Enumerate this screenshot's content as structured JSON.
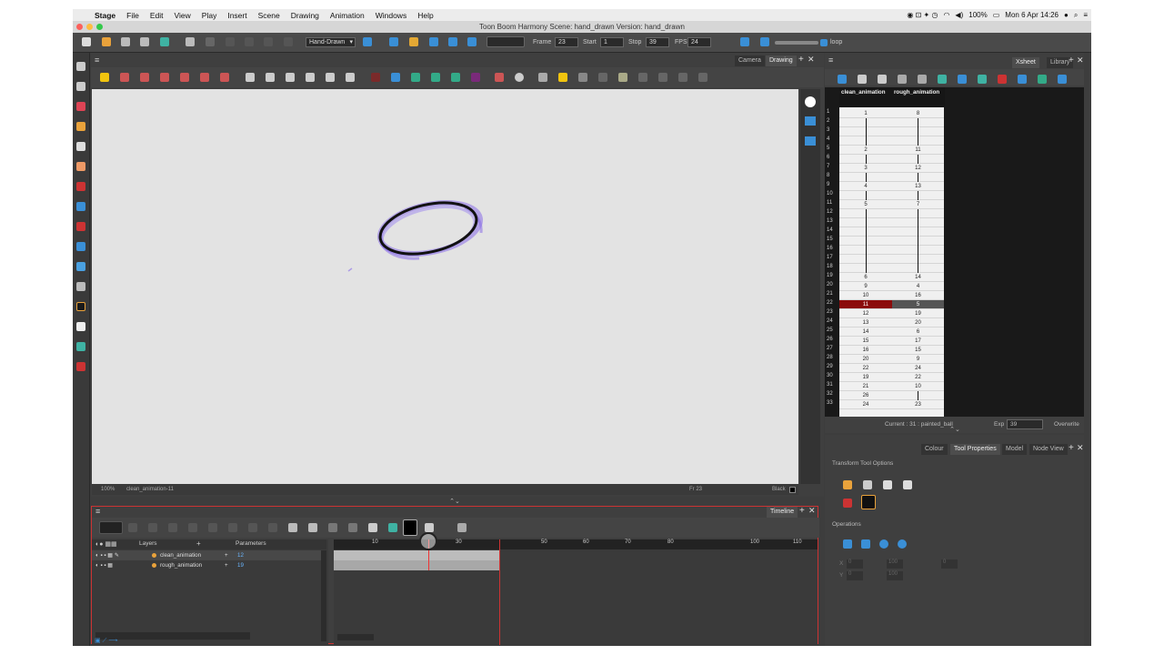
{
  "menubar": {
    "apple": "",
    "app_name": "Stage",
    "items": [
      "File",
      "Edit",
      "View",
      "Play",
      "Insert",
      "Scene",
      "Drawing",
      "Animation",
      "Windows",
      "Help"
    ],
    "battery": "100%",
    "clock": "Mon 6 Apr  14:26"
  },
  "titlebar": {
    "title": "Toon Boom Harmony Scene: hand_drawn Version: hand_drawn"
  },
  "toolbar": {
    "mode_select": "Hand-Drawn",
    "frame_label": "Frame",
    "frame_value": "23",
    "start_label": "Start",
    "start_value": "1",
    "stop_label": "Stop",
    "stop_value": "39",
    "fps_label": "FPS",
    "fps_value": "24",
    "loop_label": "loop"
  },
  "drawing_panel": {
    "tabs": [
      "Camera",
      "Drawing"
    ],
    "active_tab": "Drawing",
    "status_zoom": "100%",
    "status_drawing": "clean_animation-11",
    "status_frame": "Fr 23",
    "status_colour": "Black"
  },
  "xsheet": {
    "tabs": [
      "Xsheet",
      "Library"
    ],
    "active_tab": "Xsheet",
    "columns": [
      "clean_animation",
      "rough_animation"
    ],
    "rows": [
      {
        "n": "1",
        "a": "1",
        "b": "8"
      },
      {
        "n": "2",
        "a": "",
        "b": ""
      },
      {
        "n": "3",
        "a": "",
        "b": ""
      },
      {
        "n": "4",
        "a": "",
        "b": ""
      },
      {
        "n": "5",
        "a": "2",
        "b": "11"
      },
      {
        "n": "6",
        "a": "",
        "b": ""
      },
      {
        "n": "7",
        "a": "3",
        "b": "12"
      },
      {
        "n": "8",
        "a": "",
        "b": ""
      },
      {
        "n": "9",
        "a": "4",
        "b": "13"
      },
      {
        "n": "10",
        "a": "",
        "b": ""
      },
      {
        "n": "11",
        "a": "5",
        "b": "7"
      },
      {
        "n": "12",
        "a": "",
        "b": ""
      },
      {
        "n": "13",
        "a": "",
        "b": ""
      },
      {
        "n": "14",
        "a": "",
        "b": ""
      },
      {
        "n": "15",
        "a": "",
        "b": ""
      },
      {
        "n": "16",
        "a": "",
        "b": ""
      },
      {
        "n": "17",
        "a": "",
        "b": ""
      },
      {
        "n": "18",
        "a": "",
        "b": ""
      },
      {
        "n": "19",
        "a": "6",
        "b": "14"
      },
      {
        "n": "20",
        "a": "9",
        "b": "4"
      },
      {
        "n": "21",
        "a": "10",
        "b": "16"
      },
      {
        "n": "22",
        "a": "11",
        "b": "5"
      },
      {
        "n": "23",
        "a": "12",
        "b": "19"
      },
      {
        "n": "24",
        "a": "13",
        "b": "20"
      },
      {
        "n": "25",
        "a": "14",
        "b": "6"
      },
      {
        "n": "26",
        "a": "15",
        "b": "17"
      },
      {
        "n": "27",
        "a": "16",
        "b": "15"
      },
      {
        "n": "28",
        "a": "20",
        "b": "9"
      },
      {
        "n": "29",
        "a": "22",
        "b": "24"
      },
      {
        "n": "30",
        "a": "19",
        "b": "22"
      },
      {
        "n": "31",
        "a": "21",
        "b": "10"
      },
      {
        "n": "32",
        "a": "26",
        "b": ""
      },
      {
        "n": "33",
        "a": "24",
        "b": "23"
      }
    ],
    "current_label": "Current : 31 : painted_ball",
    "exp_label": "Exp",
    "exp_value": "39",
    "overwrite": "Overwrite"
  },
  "tool_properties": {
    "tabs": [
      "Colour",
      "Tool Properties",
      "Model",
      "Node View"
    ],
    "active_tab": "Tool Properties",
    "section_title": "Transform Tool Options",
    "operations_title": "Operations",
    "x_label": "X",
    "x_value": "0",
    "y_label": "Y",
    "y_value": "0",
    "w_value": "100",
    "h_value": "100",
    "angle_value": "0"
  },
  "timeline": {
    "tab": "Timeline",
    "layers_header": "Layers",
    "params_header": "Parameters",
    "layers": [
      {
        "name": "clean_animation",
        "param": "12"
      },
      {
        "name": "rough_animation",
        "param": "19"
      }
    ],
    "ruler": [
      "10",
      "30",
      "50",
      "60",
      "70",
      "80",
      "100",
      "110"
    ]
  },
  "colors": {
    "accent_blue": "#3a8fd6",
    "selection_red": "#8b0c0c",
    "ellipse_purple": "#8a6ee8"
  }
}
